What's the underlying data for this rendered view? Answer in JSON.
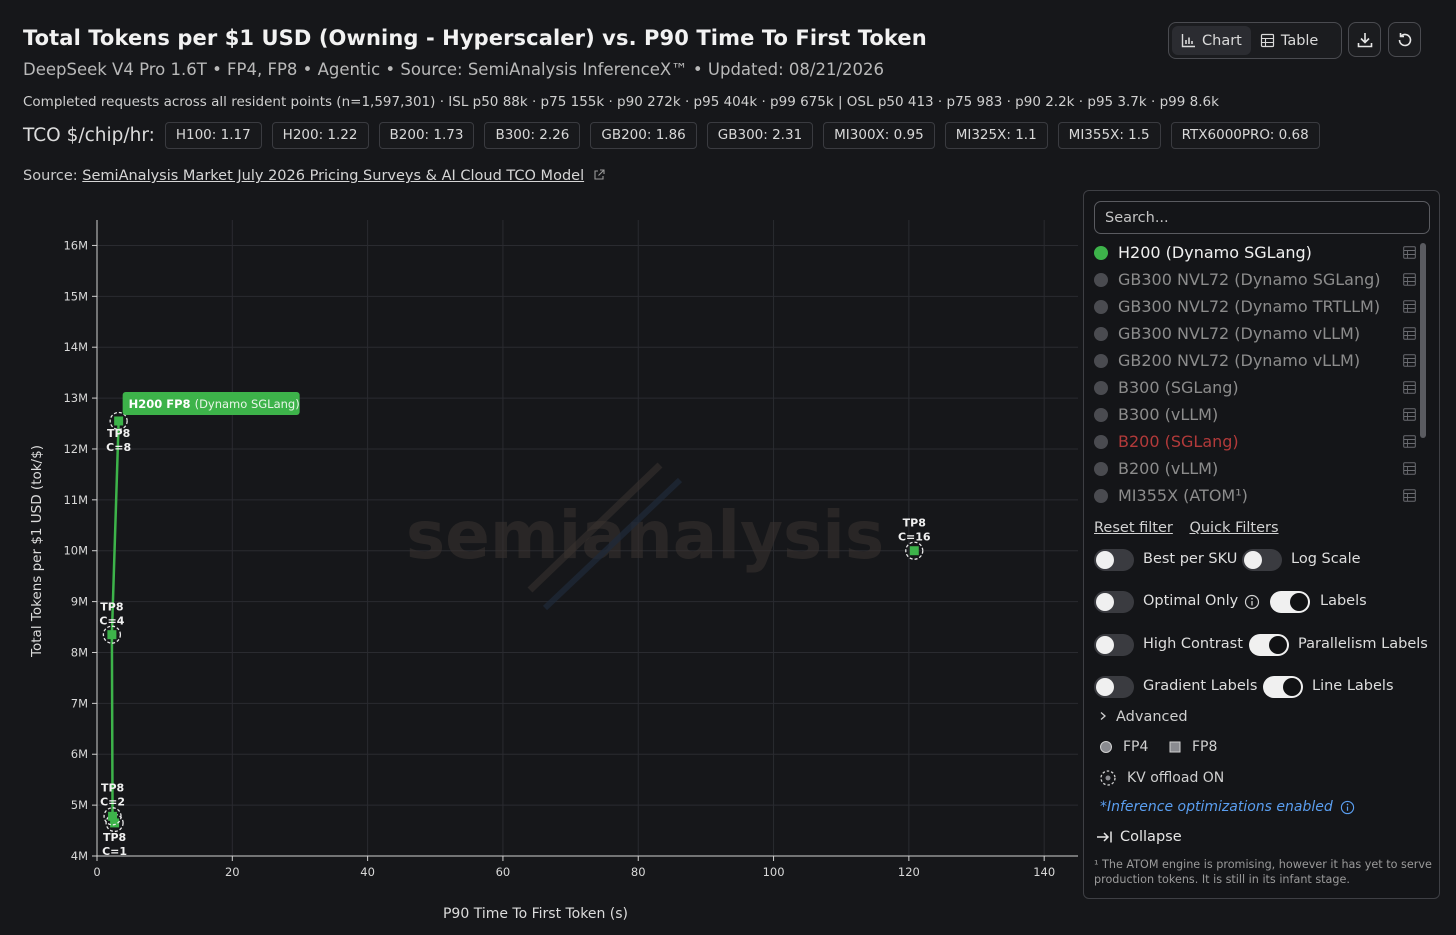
{
  "header": {
    "title": "Total Tokens per $1 USD (Owning - Hyperscaler) vs. P90 Time To First Token",
    "subtitle": "DeepSeek V4 Pro 1.6T • FP4, FP8 • Agentic • Source: SemiAnalysis InferenceX™ • Updated: 08/21/2026",
    "stats": "Completed requests across all resident points (n=1,597,301) · ISL p50 88k · p75 155k · p90 272k · p95 404k · p99 675k | OSL p50 413 · p75 983 · p90 2.2k · p95 3.7k · p99 8.6k",
    "tco_label": "TCO $/chip/hr:",
    "tco_pills": [
      "H100: 1.17",
      "H200: 1.22",
      "B200: 1.73",
      "B300: 2.26",
      "GB200: 1.86",
      "GB300: 2.31",
      "MI300X: 0.95",
      "MI325X: 1.1",
      "MI355X: 1.5",
      "RTX6000PRO: 0.68"
    ],
    "source_prefix": "Source:",
    "source_link": "SemiAnalysis Market July 2026 Pricing Surveys & AI Cloud TCO Model"
  },
  "toolbar": {
    "chart_label": "Chart",
    "table_label": "Table",
    "icons": [
      "chart-icon",
      "table-icon",
      "download-icon",
      "reset-icon"
    ]
  },
  "chart_data": {
    "type": "scatter",
    "xlabel": "P90 Time To First Token (s)",
    "ylabel": "Total Tokens per $1 USD (tok/$)",
    "xlim": [
      0,
      145
    ],
    "ylim": [
      4000000,
      16500000
    ],
    "x_ticks": [
      0,
      20,
      40,
      60,
      80,
      100,
      120,
      140
    ],
    "y_ticks": [
      4000000,
      5000000,
      6000000,
      7000000,
      8000000,
      9000000,
      10000000,
      11000000,
      12000000,
      13000000,
      14000000,
      15000000,
      16000000
    ],
    "y_tick_labels": [
      "4M",
      "5M",
      "6M",
      "7M",
      "8M",
      "9M",
      "10M",
      "11M",
      "12M",
      "13M",
      "14M",
      "15M",
      "16M"
    ],
    "grid": true,
    "watermark": "semianalysis",
    "series": [
      {
        "name": "H200 (Dynamo SGLang)",
        "color": "#3db34a",
        "marker": "square",
        "points": [
          {
            "x": 2.6,
            "y": 4650000,
            "label": [
              "TP8",
              "C=1"
            ]
          },
          {
            "x": 2.3,
            "y": 4780000,
            "label": [
              "TP8",
              "C=2"
            ]
          },
          {
            "x": 2.2,
            "y": 8350000,
            "label": [
              "TP8",
              "C=4"
            ]
          },
          {
            "x": 3.2,
            "y": 12550000,
            "label": [
              "TP8",
              "C=8"
            ]
          },
          {
            "x": 120.8,
            "y": 10000000,
            "label": [
              "TP8",
              "C=16"
            ]
          }
        ],
        "line_points": [
          0,
          1,
          2,
          3
        ],
        "line_label_bold": "H200 FP8",
        "line_label_rest": "(Dynamo SGLang)"
      }
    ]
  },
  "legend": {
    "search_placeholder": "Search...",
    "items": [
      {
        "label": "H200 (Dynamo SGLang)",
        "state": "on"
      },
      {
        "label": "GB300 NVL72 (Dynamo SGLang)",
        "state": "off"
      },
      {
        "label": "GB300 NVL72 (Dynamo TRTLLM)",
        "state": "off"
      },
      {
        "label": "GB300 NVL72 (Dynamo vLLM)",
        "state": "off"
      },
      {
        "label": "GB200 NVL72 (Dynamo vLLM)",
        "state": "off"
      },
      {
        "label": "B300 (SGLang)",
        "state": "off"
      },
      {
        "label": "B300 (vLLM)",
        "state": "off"
      },
      {
        "label": "B200 (SGLang)",
        "state": "red"
      },
      {
        "label": "B200 (vLLM)",
        "state": "off"
      },
      {
        "label": "MI355X (ATOM¹)",
        "state": "off"
      }
    ],
    "reset_filter": "Reset filter",
    "quick_filters": "Quick Filters",
    "toggles": {
      "best_per_sku": {
        "label": "Best per SKU",
        "on": false
      },
      "log_scale": {
        "label": "Log Scale",
        "on": false
      },
      "optimal_only": {
        "label": "Optimal Only",
        "on": false
      },
      "labels": {
        "label": "Labels",
        "on": true
      },
      "high_contrast": {
        "label": "High Contrast",
        "on": false
      },
      "parallelism_labels": {
        "label": "Parallelism Labels",
        "on": true
      },
      "gradient_labels": {
        "label": "Gradient Labels",
        "on": false
      },
      "line_labels": {
        "label": "Line Labels",
        "on": true
      }
    },
    "advanced": "Advanced",
    "fp4": "FP4",
    "fp8": "FP8",
    "kv_offload": "KV offload ON",
    "optimizations_note": "*Inference optimizations enabled",
    "collapse": "Collapse",
    "footnote": "¹ The ATOM engine is promising, however it has yet to serve production tokens. It is still in its infant stage."
  }
}
